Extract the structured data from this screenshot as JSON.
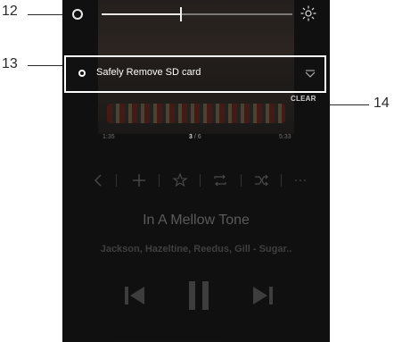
{
  "callouts": {
    "n12": "12",
    "n13": "13",
    "n14": "14"
  },
  "brightness": {
    "level": 0.41
  },
  "sd": {
    "label": "Safely Remove SD card"
  },
  "clear": {
    "label": "CLEAR"
  },
  "time": {
    "elapsed": "1:35",
    "track_num": "3",
    "track_sep": " / ",
    "track_total": "6",
    "total": "5:33"
  },
  "song": {
    "title": "In A Mellow Tone",
    "artist": "Jackson, Hazeltine, Reedus, Gill - Sugar.."
  },
  "icons": {
    "brightness": "circle-icon",
    "sun": "sun-icon",
    "dropdown": "chevron-down-icon",
    "back": "chevron-left-icon",
    "add": "plus-icon",
    "favorite": "star-icon",
    "repeat": "repeat-icon",
    "shuffle": "shuffle-icon",
    "more": "more-icon",
    "previous": "skip-previous-icon",
    "pause": "pause-icon",
    "next": "skip-next-icon"
  },
  "colors": {
    "background": "#1a1a1a",
    "accent": "#e8e8e8",
    "callout": "#2a2a2a"
  }
}
